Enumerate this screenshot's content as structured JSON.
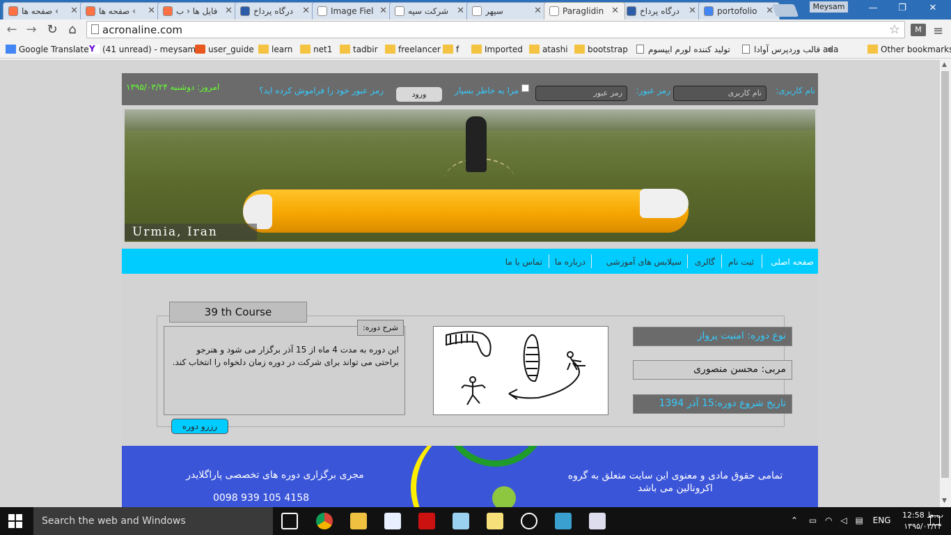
{
  "browser": {
    "tabs": [
      {
        "title": "صفحه ها ‹",
        "color": "#ff7043",
        "active": false
      },
      {
        "title": "صفحه ها ‹",
        "color": "#ff7043",
        "active": false
      },
      {
        "title": "فایل ها ‹ ب",
        "color": "#ff7043",
        "active": false
      },
      {
        "title": "درگاه پرداخ",
        "color": "#2a5caa",
        "active": false
      },
      {
        "title": "Image Fiel",
        "color": "#ffffff",
        "active": false
      },
      {
        "title": "شرکت سپه",
        "color": "#ffffff",
        "active": false
      },
      {
        "title": "سپهر",
        "color": "#ffffff",
        "active": false
      },
      {
        "title": "Paraglidin",
        "color": "#ffffff",
        "active": true
      },
      {
        "title": "درگاه پرداخ",
        "color": "#2a5caa",
        "active": false
      },
      {
        "title": "portofolio",
        "color": "#4285f4",
        "active": false
      }
    ],
    "user_label": "Meysam",
    "url": "acronaline.com",
    "bookmarks": [
      {
        "label": "Google Translate",
        "icon": "translate-icon"
      },
      {
        "label": "(41 unread) - meysam",
        "icon": "yahoo-icon"
      },
      {
        "label": "user_guide",
        "icon": "codeigniter-icon"
      },
      {
        "label": "learn",
        "icon": "folder-icon"
      },
      {
        "label": "net1",
        "icon": "folder-icon"
      },
      {
        "label": "tadbir",
        "icon": "folder-icon"
      },
      {
        "label": "freelancer",
        "icon": "folder-icon"
      },
      {
        "label": "f",
        "icon": "folder-icon"
      },
      {
        "label": "Imported",
        "icon": "folder-icon"
      },
      {
        "label": "atashi",
        "icon": "folder-icon"
      },
      {
        "label": "bootstrap",
        "icon": "folder-icon"
      },
      {
        "label": "تولید کننده لورم ایپسوم",
        "icon": "page-icon"
      },
      {
        "label": "قالب وردپرس آوادا ada",
        "icon": "page-icon"
      },
      {
        "label": "»",
        "icon": ""
      },
      {
        "label": "Other bookmarks",
        "icon": "folder-icon"
      }
    ]
  },
  "site": {
    "login": {
      "username_label": "نام کاربری:",
      "username_placeholder": "نام کاربری",
      "password_label": "رمز عبور:",
      "password_placeholder": "رمز عبور",
      "remember_label": "مرا به خاطر بسپار",
      "login_button": "ورود",
      "forgot_link": "رمز عبور خود را فراموش کرده اید؟",
      "today": "امروز: دوشنبه ۱۳۹۵/۰۳/۲۴"
    },
    "banner_caption": "Urmia, Iran",
    "nav": [
      "صفحه اصلی",
      "ثبت نام",
      "گالری",
      "سیلابس های آموزشی",
      "درباره ما",
      "تماس با ما"
    ],
    "course": {
      "tab_title": "39 th Course",
      "desc_label": "شرح دوره:",
      "description": "این دوره به مدت 4 ماه از 15 آذر برگزار می شود و هنرجو براحتی می تواند برای شرکت در دوره زمان دلخواه را انتخاب کند.",
      "reserve_button": "رزرو دوره",
      "type": "نوع دوره: امنیت پرواز",
      "coach": "مربی: محسن منصوری",
      "start_date": "تاریخ شروع دوره:15 آذر 1394"
    },
    "footer": {
      "rights": "تمامی حقوق مادی و معنوی این سایت متعلق به گروه اکرونالین می باشد",
      "organizer": "مجری برگزاری دوره های تخصصی پاراگلایدر",
      "phone": "0098 939 105 4158"
    }
  },
  "taskbar": {
    "search_placeholder": "Search the web and Windows",
    "lang": "ENG",
    "time": "12:58 ب.ظ",
    "date": "۱۳۹۵/۰۳/۲۴"
  },
  "colors": {
    "nav_bg": "#00ccff",
    "login_text": "#33ccff",
    "date_text": "#66ff33",
    "footer_bg": "#3b55d9"
  }
}
